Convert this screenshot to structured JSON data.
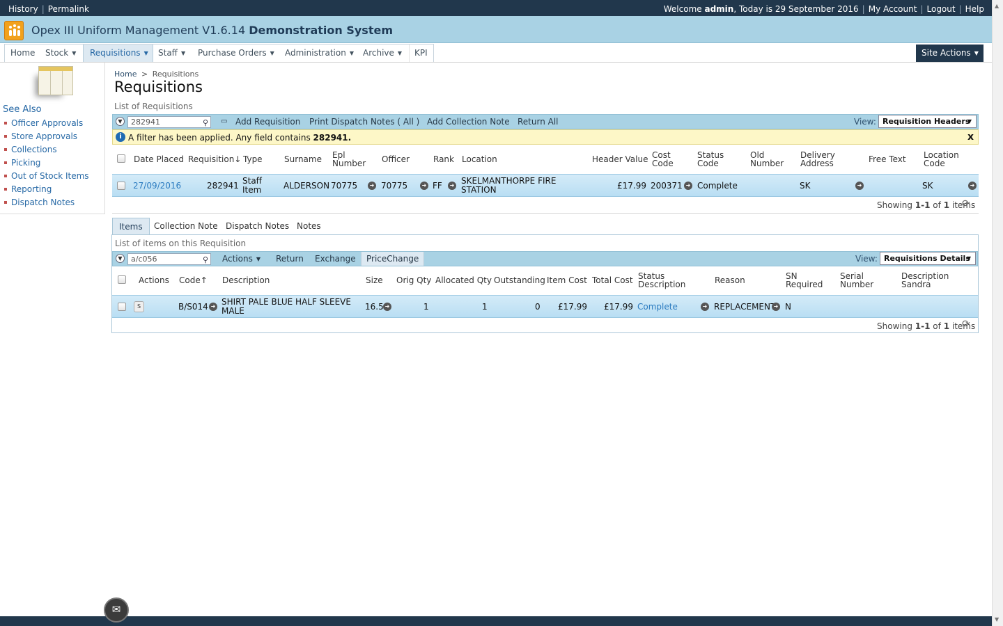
{
  "topbar": {
    "history": "History",
    "permalink": "Permalink",
    "welcome_prefix": "Welcome",
    "user": "admin",
    "today": ", Today is 29 September 2016",
    "my_account": "My Account",
    "logout": "Logout",
    "help": "Help"
  },
  "app": {
    "title": "Opex III Uniform Management V1.6.14",
    "system": "Demonstration System"
  },
  "nav": {
    "items": [
      "Home",
      "Stock",
      "Requisitions",
      "Staff",
      "Purchase Orders",
      "Administration",
      "Archive",
      "KPI"
    ],
    "active": "Requisitions",
    "site_actions": "Site Actions"
  },
  "sidebar": {
    "see_also": "See Also",
    "links": [
      "Officer Approvals",
      "Store Approvals",
      "Collections",
      "Picking",
      "Out of Stock Items",
      "Reporting",
      "Dispatch Notes"
    ]
  },
  "breadcrumb": {
    "home": "Home",
    "sep": ">",
    "current": "Requisitions"
  },
  "page_title": "Requisitions",
  "requisitions": {
    "section_label": "List of Requisitions",
    "filter_value": "282941",
    "toolbar": [
      "Add Requisition",
      "Print Dispatch Notes ( All )",
      "Add Collection Note",
      "Return All"
    ],
    "view_label": "View:",
    "view_value": "Requisition Headers",
    "filter_msg": "A filter has been applied. Any field contains",
    "filter_term": "282941.",
    "headers": {
      "date_placed": "Date Placed",
      "requisition": "Requisition",
      "type": "Type",
      "surname": "Surname",
      "epl_1": "Epl",
      "epl_2": "Number",
      "officer": "Officer",
      "rank": "Rank",
      "location": "Location",
      "header_value": "Header Value",
      "cost_1": "Cost",
      "cost_2": "Code",
      "status_1": "Status",
      "status_2": "Code",
      "old_1": "Old",
      "old_2": "Number",
      "delivery_1": "Delivery",
      "delivery_2": "Address",
      "free_text": "Free Text",
      "loc_code_1": "Location",
      "loc_code_2": "Code"
    },
    "row": {
      "date_placed": "27/09/2016",
      "requisition": "282941",
      "type_1": "Staff",
      "type_2": "Item",
      "surname": "ALDERSON",
      "epl_number": "70775",
      "officer": "70775",
      "rank": "FF",
      "location_1": "SKELMANTHORPE FIRE",
      "location_2": "STATION",
      "header_value": "£17.99",
      "cost_code": "200371",
      "status_code": "Complete",
      "delivery_address": "SK",
      "location_code": "SK"
    },
    "footer": {
      "showing": "Showing",
      "range": "1-1",
      "of": "of",
      "count": "1",
      "items": "items"
    }
  },
  "tabs": [
    "Items",
    "Collection Note",
    "Dispatch Notes",
    "Notes"
  ],
  "items": {
    "section_label": "List of items on this Requisition",
    "filter_value": "a/c056",
    "toolbar": [
      "Actions",
      "Return",
      "Exchange",
      "PriceChange"
    ],
    "view_label": "View:",
    "view_value": "Requisitions Details",
    "headers": {
      "actions": "Actions",
      "code": "Code",
      "description": "Description",
      "size": "Size",
      "orig_qty": "Orig Qty",
      "allocated_qty": "Allocated Qty",
      "outstanding": "Outstanding",
      "item_cost": "Item Cost",
      "total_cost": "Total Cost",
      "status_1": "Status",
      "status_2": "Description",
      "reason": "Reason",
      "sn_1": "SN",
      "sn_2": "Required",
      "serial_1": "Serial",
      "serial_2": "Number",
      "desc_s_1": "Description",
      "desc_s_2": "Sandra"
    },
    "row": {
      "action_badge": "S",
      "code": "B/S014",
      "description_1": "SHIRT PALE BLUE HALF SLEEVE",
      "description_2": "MALE",
      "size": "16.5",
      "orig_qty": "1",
      "allocated_qty": "1",
      "outstanding": "0",
      "item_cost": "£17.99",
      "total_cost": "£17.99",
      "status": "Complete",
      "reason": "REPLACEMENT",
      "sn_required": "N"
    },
    "footer": {
      "showing": "Showing",
      "range": "1-1",
      "of": "of",
      "count": "1",
      "items": "items"
    }
  },
  "icons": {
    "info": "i",
    "close": "x",
    "mail": "✉",
    "refresh": "⟳",
    "go": "➜"
  }
}
